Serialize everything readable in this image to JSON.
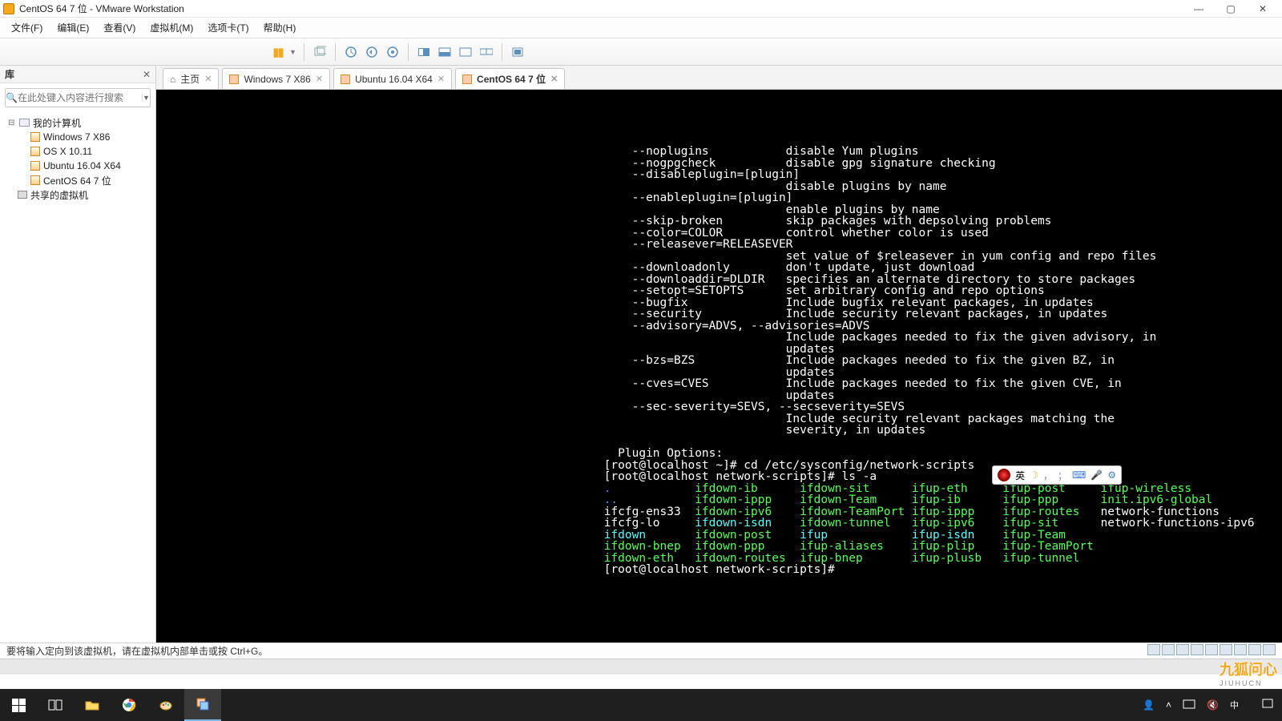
{
  "window": {
    "title": "CentOS 64 7 位 - VMware Workstation"
  },
  "menus": [
    "文件(F)",
    "编辑(E)",
    "查看(V)",
    "虚拟机(M)",
    "选项卡(T)",
    "帮助(H)"
  ],
  "library": {
    "title": "库",
    "search_placeholder": "在此处键入内容进行搜索",
    "root": "我的计算机",
    "vms": [
      "Windows 7 X86",
      "OS X 10.11",
      "Ubuntu 16.04 X64",
      "CentOS 64 7 位"
    ],
    "shared": "共享的虚拟机"
  },
  "tabs": [
    {
      "label": "主页",
      "home": true
    },
    {
      "label": "Windows 7 X86"
    },
    {
      "label": "Ubuntu 16.04 X64"
    },
    {
      "label": "CentOS 64 7 位",
      "active": true
    }
  ],
  "status_hint": "要将输入定向到该虚拟机，请在虚拟机内部单击或按 Ctrl+G。",
  "ime_text": "英",
  "clock": {
    "time": "",
    "date": ""
  },
  "watermark": {
    "big": "九狐问心",
    "small": "JIUHUCN"
  },
  "terminal": {
    "options": [
      [
        "--noplugins",
        "disable Yum plugins"
      ],
      [
        "--nogpgcheck",
        "disable gpg signature checking"
      ],
      [
        "--disableplugin=[plugin]",
        ""
      ],
      [
        "",
        "disable plugins by name"
      ],
      [
        "--enableplugin=[plugin]",
        ""
      ],
      [
        "",
        "enable plugins by name"
      ],
      [
        "--skip-broken",
        "skip packages with depsolving problems"
      ],
      [
        "--color=COLOR",
        "control whether color is used"
      ],
      [
        "--releasever=RELEASEVER",
        ""
      ],
      [
        "",
        "set value of $releasever in yum config and repo files"
      ],
      [
        "--downloadonly",
        "don't update, just download"
      ],
      [
        "--downloaddir=DLDIR",
        "specifies an alternate directory to store packages"
      ],
      [
        "--setopt=SETOPTS",
        "set arbitrary config and repo options"
      ],
      [
        "--bugfix",
        "Include bugfix relevant packages, in updates"
      ],
      [
        "--security",
        "Include security relevant packages, in updates"
      ],
      [
        "--advisory=ADVS, --advisories=ADVS",
        ""
      ],
      [
        "",
        "Include packages needed to fix the given advisory, in"
      ],
      [
        "",
        "updates"
      ],
      [
        "--bzs=BZS",
        "Include packages needed to fix the given BZ, in"
      ],
      [
        "",
        "updates"
      ],
      [
        "--cves=CVES",
        "Include packages needed to fix the given CVE, in"
      ],
      [
        "",
        "updates"
      ],
      [
        "--sec-severity=SEVS, --secseverity=SEVS",
        ""
      ],
      [
        "",
        "Include security relevant packages matching the"
      ],
      [
        "",
        "severity, in updates"
      ]
    ],
    "plugin_hdr": "  Plugin Options:",
    "prompt1": "[root@localhost ~]# ",
    "cmd1": "cd /etc/sysconfig/network-scripts",
    "prompt2": "[root@localhost network-scripts]# ",
    "cmd2": "ls -a",
    "listing": {
      "cols": [
        13,
        15,
        16,
        13,
        14,
        23
      ],
      "rows": [
        [
          {
            "t": ".",
            "c": "b"
          },
          {
            "t": "ifdown-ib",
            "c": "g"
          },
          {
            "t": "ifdown-sit",
            "c": "g"
          },
          {
            "t": "ifup-eth",
            "c": "g"
          },
          {
            "t": "ifup-post",
            "c": "g"
          },
          {
            "t": "ifup-wireless",
            "c": "g"
          }
        ],
        [
          {
            "t": "..",
            "c": "b"
          },
          {
            "t": "ifdown-ippp",
            "c": "g"
          },
          {
            "t": "ifdown-Team",
            "c": "g"
          },
          {
            "t": "ifup-ib",
            "c": "g"
          },
          {
            "t": "ifup-ppp",
            "c": "g"
          },
          {
            "t": "init.ipv6-global",
            "c": "g"
          }
        ],
        [
          {
            "t": "ifcfg-ens33",
            "c": "w"
          },
          {
            "t": "ifdown-ipv6",
            "c": "g"
          },
          {
            "t": "ifdown-TeamPort",
            "c": "g"
          },
          {
            "t": "ifup-ippp",
            "c": "g"
          },
          {
            "t": "ifup-routes",
            "c": "g"
          },
          {
            "t": "network-functions",
            "c": "w"
          }
        ],
        [
          {
            "t": "ifcfg-lo",
            "c": "w"
          },
          {
            "t": "ifdown-isdn",
            "c": "c"
          },
          {
            "t": "ifdown-tunnel",
            "c": "g"
          },
          {
            "t": "ifup-ipv6",
            "c": "g"
          },
          {
            "t": "ifup-sit",
            "c": "g"
          },
          {
            "t": "network-functions-ipv6",
            "c": "w"
          }
        ],
        [
          {
            "t": "ifdown",
            "c": "c"
          },
          {
            "t": "ifdown-post",
            "c": "g"
          },
          {
            "t": "ifup",
            "c": "c"
          },
          {
            "t": "ifup-isdn",
            "c": "c"
          },
          {
            "t": "ifup-Team",
            "c": "g"
          },
          {
            "t": "",
            "c": "w"
          }
        ],
        [
          {
            "t": "ifdown-bnep",
            "c": "g"
          },
          {
            "t": "ifdown-ppp",
            "c": "g"
          },
          {
            "t": "ifup-aliases",
            "c": "g"
          },
          {
            "t": "ifup-plip",
            "c": "g"
          },
          {
            "t": "ifup-TeamPort",
            "c": "g"
          },
          {
            "t": "",
            "c": "w"
          }
        ],
        [
          {
            "t": "ifdown-eth",
            "c": "g"
          },
          {
            "t": "ifdown-routes",
            "c": "g"
          },
          {
            "t": "ifup-bnep",
            "c": "g"
          },
          {
            "t": "ifup-plusb",
            "c": "g"
          },
          {
            "t": "ifup-tunnel",
            "c": "g"
          },
          {
            "t": "",
            "c": "w"
          }
        ]
      ]
    },
    "prompt3": "[root@localhost network-scripts]# "
  }
}
